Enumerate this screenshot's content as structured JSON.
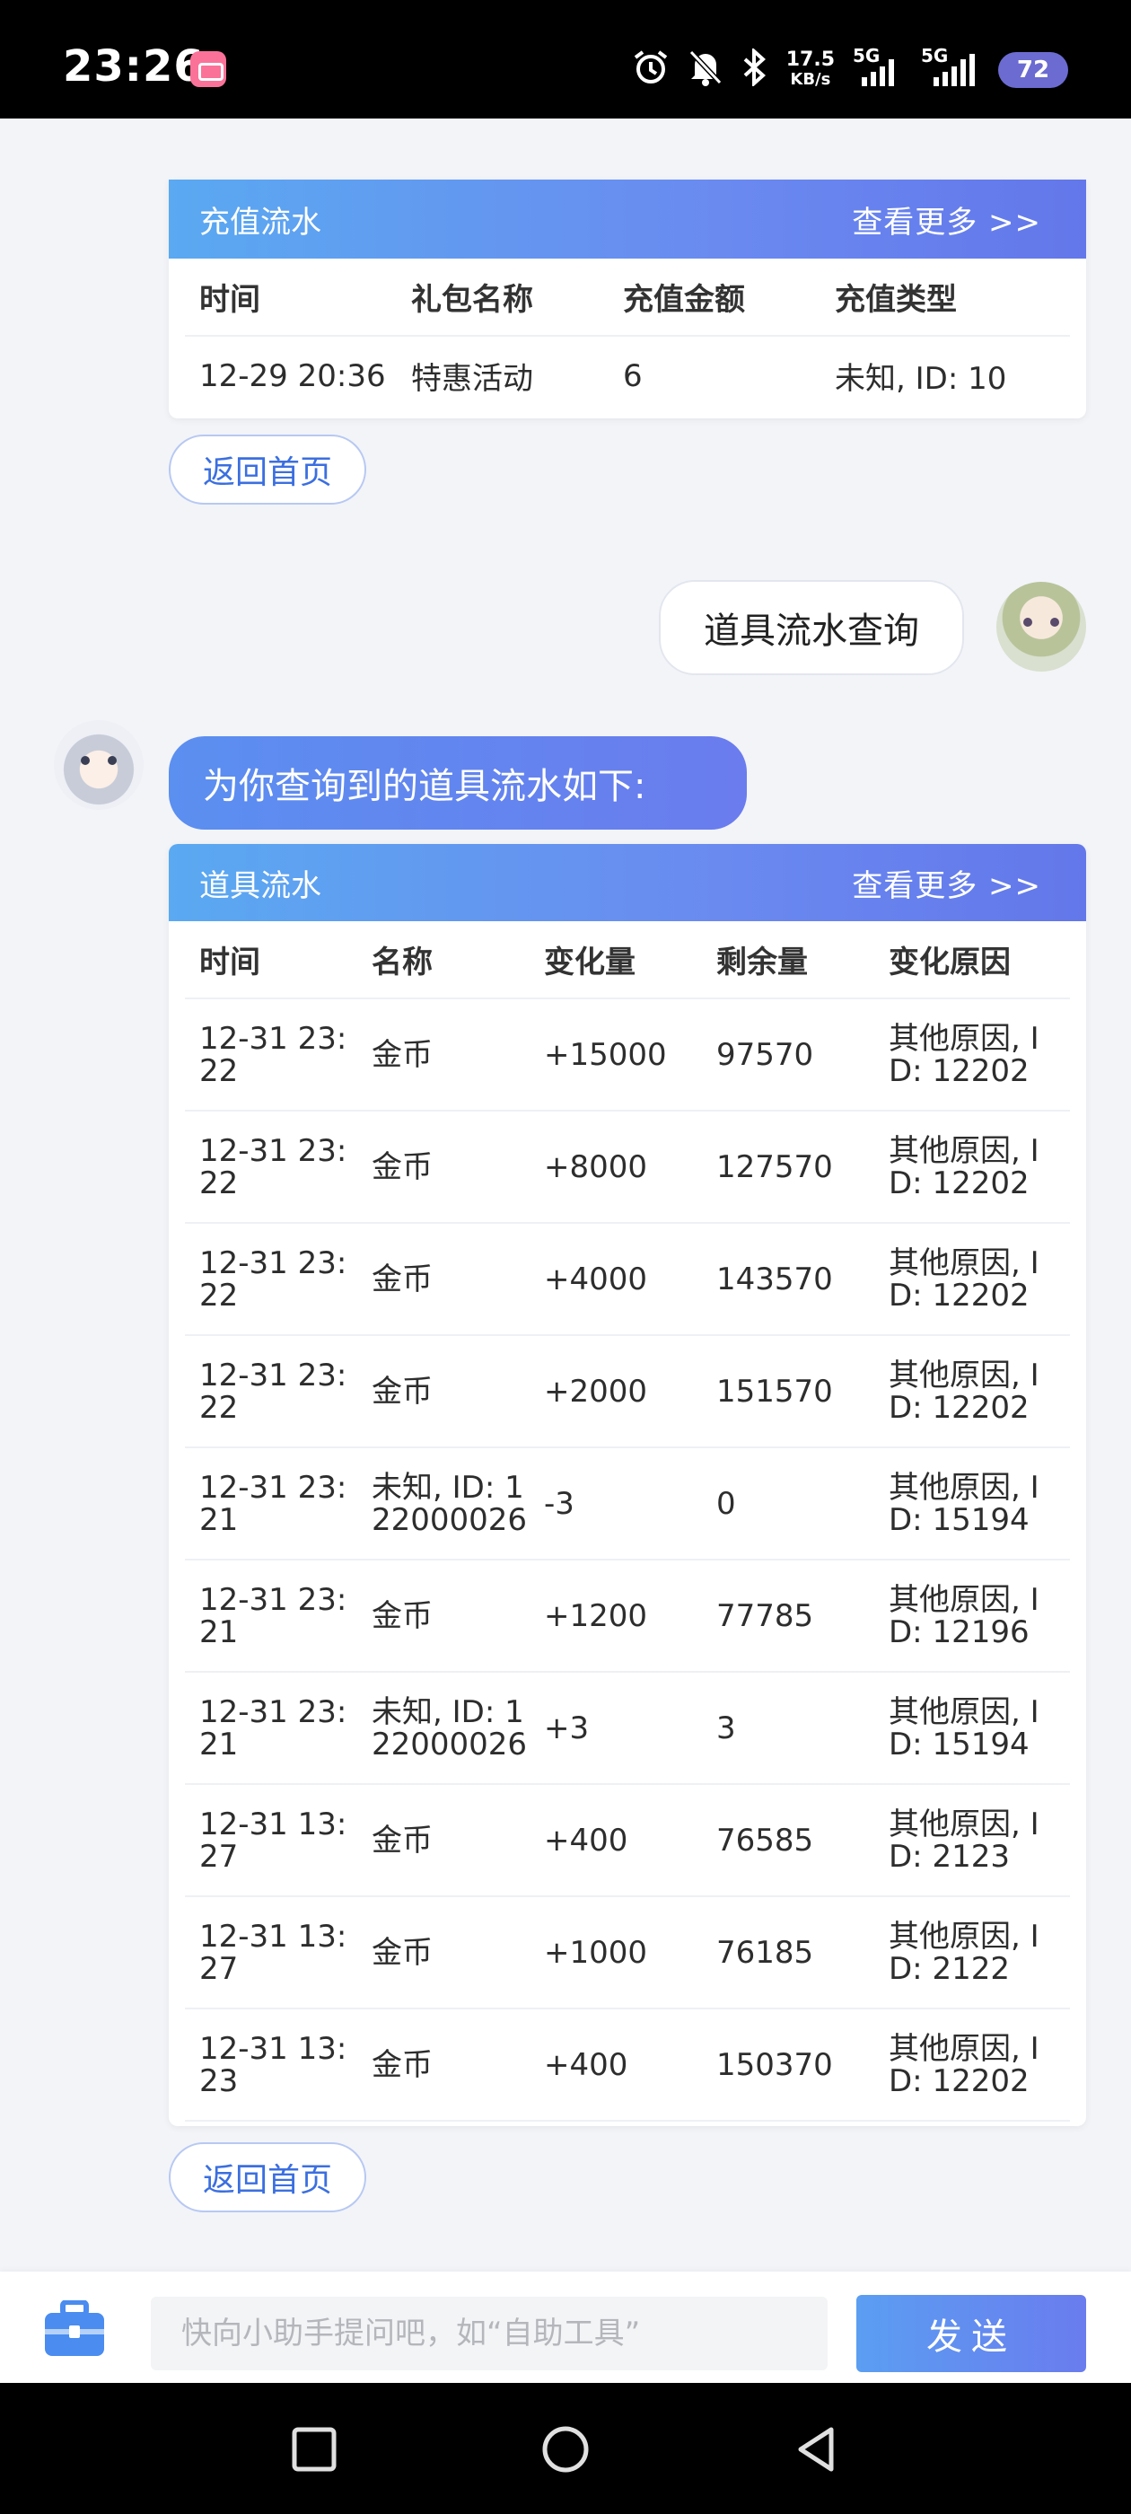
{
  "status_bar": {
    "time": "23:26",
    "net_speed_value": "17.5",
    "net_speed_unit": "KB/s",
    "signal1_label": "5G",
    "signal2_label": "5G",
    "battery": "72",
    "icons": [
      "alarm-icon",
      "bell-off-icon",
      "bluetooth-icon"
    ]
  },
  "recharge_card": {
    "title": "充值流水",
    "more": "查看更多 >>",
    "columns": [
      "时间",
      "礼包名称",
      "充值金额",
      "充值类型"
    ],
    "rows": [
      [
        "12-29 20:36",
        "特惠活动",
        "6",
        "未知, ID: 10"
      ]
    ]
  },
  "home_button_label": "返回首页",
  "user_message": "道具流水查询",
  "bot_message": "为你查询到的道具流水如下:",
  "item_card": {
    "title": "道具流水",
    "more": "查看更多 >>",
    "columns": [
      "时间",
      "名称",
      "变化量",
      "剩余量",
      "变化原因"
    ],
    "rows": [
      [
        "12-31 23:22",
        "金币",
        "+15000",
        "97570",
        "其他原因, ID: 12202"
      ],
      [
        "12-31 23:22",
        "金币",
        "+8000",
        "127570",
        "其他原因, ID: 12202"
      ],
      [
        "12-31 23:22",
        "金币",
        "+4000",
        "143570",
        "其他原因, ID: 12202"
      ],
      [
        "12-31 23:22",
        "金币",
        "+2000",
        "151570",
        "其他原因, ID: 12202"
      ],
      [
        "12-31 23:21",
        "未知, ID: 122000026",
        "-3",
        "0",
        "其他原因, ID: 15194"
      ],
      [
        "12-31 23:21",
        "金币",
        "+1200",
        "77785",
        "其他原因, ID: 12196"
      ],
      [
        "12-31 23:21",
        "未知, ID: 122000026",
        "+3",
        "3",
        "其他原因, ID: 15194"
      ],
      [
        "12-31 13:27",
        "金币",
        "+400",
        "76585",
        "其他原因, ID: 2123"
      ],
      [
        "12-31 13:27",
        "金币",
        "+1000",
        "76185",
        "其他原因, ID: 2122"
      ],
      [
        "12-31 13:23",
        "金币",
        "+400",
        "150370",
        "其他原因, ID: 12202"
      ]
    ]
  },
  "input_bar": {
    "placeholder": "快向小助手提问吧，如“自助工具”",
    "send_label": "发送"
  },
  "colors": {
    "accent": "#6a8af0",
    "accent_light": "#5aa9f1",
    "page_bg": "#f2f4f8"
  }
}
